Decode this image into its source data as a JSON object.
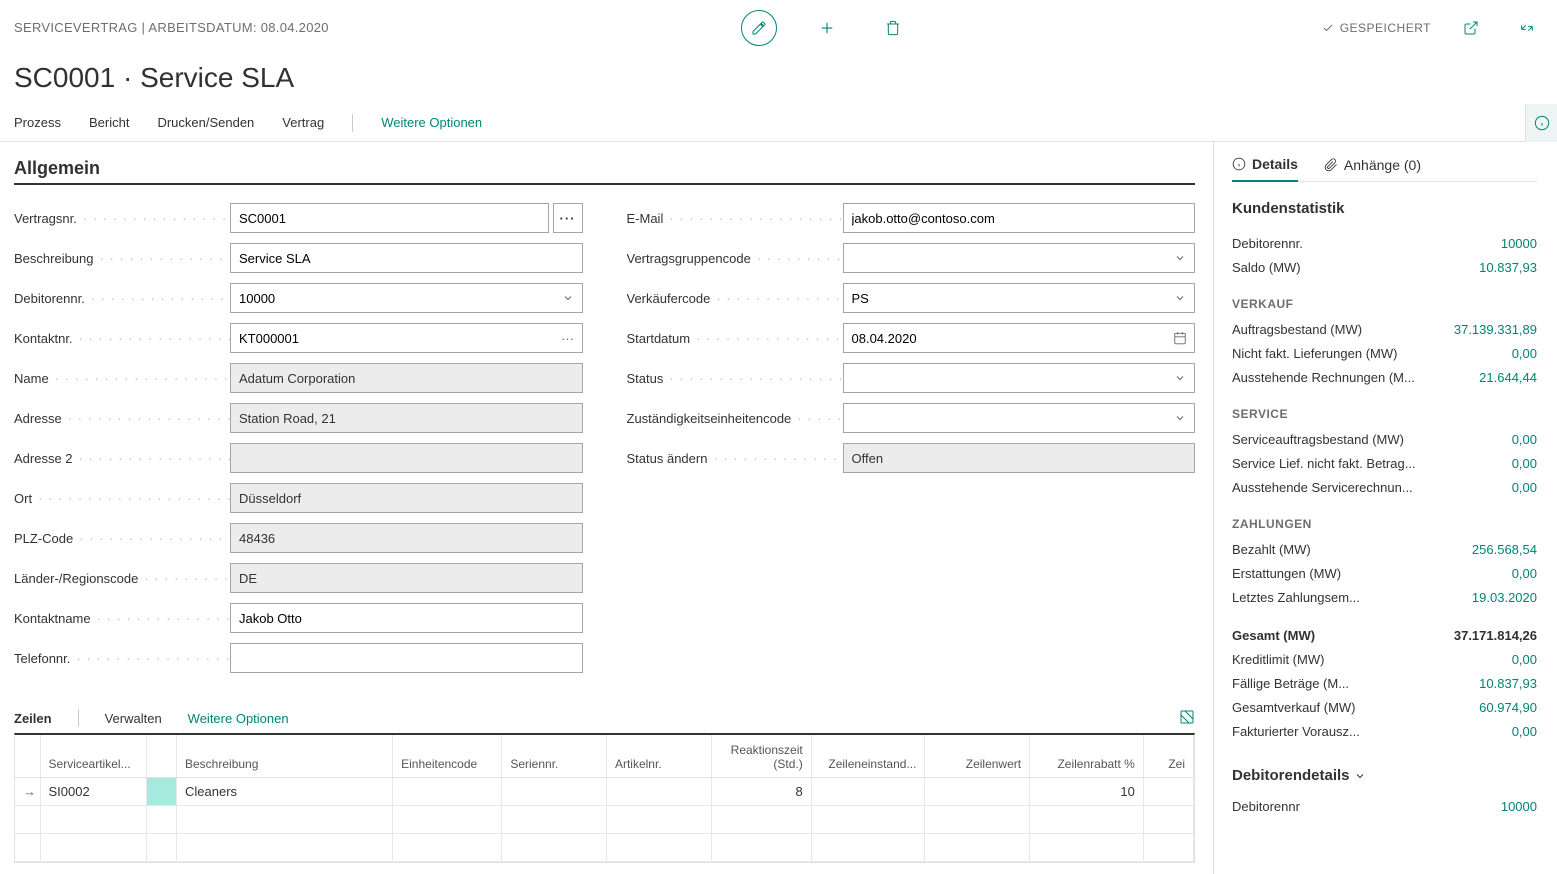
{
  "header": {
    "breadcrumb": "SERVICEVERTRAG | ARBEITSDATUM: 08.04.2020",
    "saved": "GESPEICHERT"
  },
  "title": "SC0001 · Service SLA",
  "menu": {
    "process": "Prozess",
    "report": "Bericht",
    "printsend": "Drucken/Senden",
    "contract": "Vertrag",
    "more": "Weitere Optionen"
  },
  "general": {
    "heading": "Allgemein",
    "labels": {
      "contractNo": "Vertragsnr.",
      "description": "Beschreibung",
      "customerNo": "Debitorennr.",
      "contactNo": "Kontaktnr.",
      "name": "Name",
      "address": "Adresse",
      "address2": "Adresse 2",
      "city": "Ort",
      "postcode": "PLZ-Code",
      "country": "Länder-/Regionscode",
      "contactName": "Kontaktname",
      "phone": "Telefonnr.",
      "email": "E-Mail",
      "groupCode": "Vertragsgruppencode",
      "salesCode": "Verkäufercode",
      "startDate": "Startdatum",
      "status": "Status",
      "respCenter": "Zuständigkeitseinheitencode",
      "changeStatus": "Status ändern"
    },
    "values": {
      "contractNo": "SC0001",
      "description": "Service SLA",
      "customerNo": "10000",
      "contactNo": "KT000001",
      "name": "Adatum Corporation",
      "address": "Station Road, 21",
      "address2": "",
      "city": "Düsseldorf",
      "postcode": "48436",
      "country": "DE",
      "contactName": "Jakob Otto",
      "phone": "",
      "email": "jakob.otto@contoso.com",
      "groupCode": "",
      "salesCode": "PS",
      "startDate": "08.04.2020",
      "status": "",
      "respCenter": "",
      "changeStatus": "Offen"
    }
  },
  "lines": {
    "tab": "Zeilen",
    "manage": "Verwalten",
    "more": "Weitere Optionen",
    "cols": {
      "serviceItem": "Serviceartikel...",
      "description": "Beschreibung",
      "unitCode": "Einheitencode",
      "serialNo": "Seriennr.",
      "itemNo": "Artikelnr.",
      "response": "Reaktionszeit (Std.)",
      "lineCost": "Zeileneinstand...",
      "lineValue": "Zeilenwert",
      "lineDisc": "Zeilenrabatt %",
      "lineExtra": "Zei"
    },
    "rows": [
      {
        "serviceItem": "SI0002",
        "description": "Cleaners",
        "response": "8",
        "lineDisc": "10"
      }
    ]
  },
  "side": {
    "detailsTab": "Details",
    "attachTab": "Anhänge (0)",
    "statsHdr": "Kundenstatistik",
    "debNoL": "Debitorennr.",
    "debNoV": "10000",
    "balL": "Saldo (MW)",
    "balV": "10.837,93",
    "salesHdr": "VERKAUF",
    "s1L": "Auftragsbestand (MW)",
    "s1V": "37.139.331,89",
    "s2L": "Nicht fakt. Lieferungen (MW)",
    "s2V": "0,00",
    "s3L": "Ausstehende Rechnungen (M...",
    "s3V": "21.644,44",
    "serviceHdr": "SERVICE",
    "v1L": "Serviceauftragsbestand (MW)",
    "v1V": "0,00",
    "v2L": "Service Lief. nicht fakt. Betrag...",
    "v2V": "0,00",
    "v3L": "Ausstehende Servicerechnun...",
    "v3V": "0,00",
    "payHdr": "ZAHLUNGEN",
    "p1L": "Bezahlt (MW)",
    "p1V": "256.568,54",
    "p2L": "Erstattungen (MW)",
    "p2V": "0,00",
    "p3L": "Letztes Zahlungsem...",
    "p3V": "19.03.2020",
    "totL": "Gesamt (MW)",
    "totV": "37.171.814,26",
    "c1L": "Kreditlimit (MW)",
    "c1V": "0,00",
    "c2L": "Fällige Beträge (M...",
    "c2V": "10.837,93",
    "c3L": "Gesamtverkauf (MW)",
    "c3V": "60.974,90",
    "c4L": "Fakturierter Vorausz...",
    "c4V": "0,00",
    "detailsHdr": "Debitorendetails",
    "d1L": "Debitorennr",
    "d1V": "10000"
  }
}
